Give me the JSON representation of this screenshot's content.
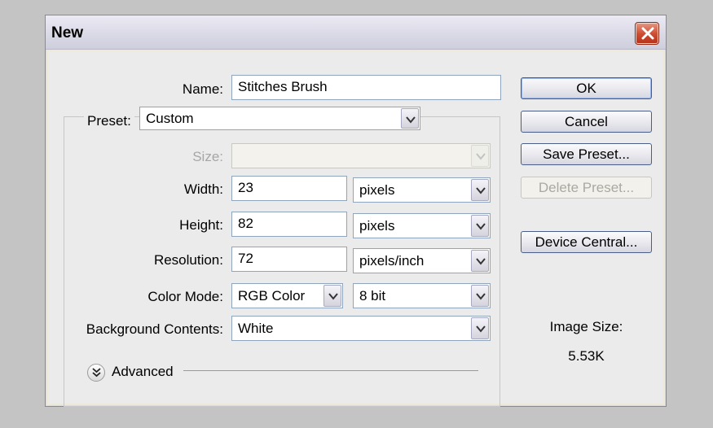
{
  "window": {
    "title": "New"
  },
  "form": {
    "name": {
      "label": "Name:",
      "value": "Stitches Brush"
    },
    "preset": {
      "label": "Preset:",
      "value": "Custom"
    },
    "size": {
      "label": "Size:",
      "value": ""
    },
    "width": {
      "label": "Width:",
      "value": "23",
      "unit": "pixels"
    },
    "height": {
      "label": "Height:",
      "value": "82",
      "unit": "pixels"
    },
    "resolution": {
      "label": "Resolution:",
      "value": "72",
      "unit": "pixels/inch"
    },
    "color_mode": {
      "label": "Color Mode:",
      "value": "RGB Color",
      "depth": "8 bit"
    },
    "background": {
      "label": "Background Contents:",
      "value": "White"
    },
    "advanced": {
      "label": "Advanced"
    }
  },
  "buttons": {
    "ok": "OK",
    "cancel": "Cancel",
    "save_preset": "Save Preset...",
    "delete_preset": "Delete Preset...",
    "device_central": "Device Central..."
  },
  "image_size": {
    "label": "Image Size:",
    "value": "5.53K"
  },
  "icons": {
    "close": "close-icon",
    "dropdown": "chevron-down-icon",
    "advanced_toggle": "double-chevron-down-icon"
  },
  "colors": {
    "close_button": "#cc4a2f",
    "dialog_bg": "#ecebec"
  }
}
